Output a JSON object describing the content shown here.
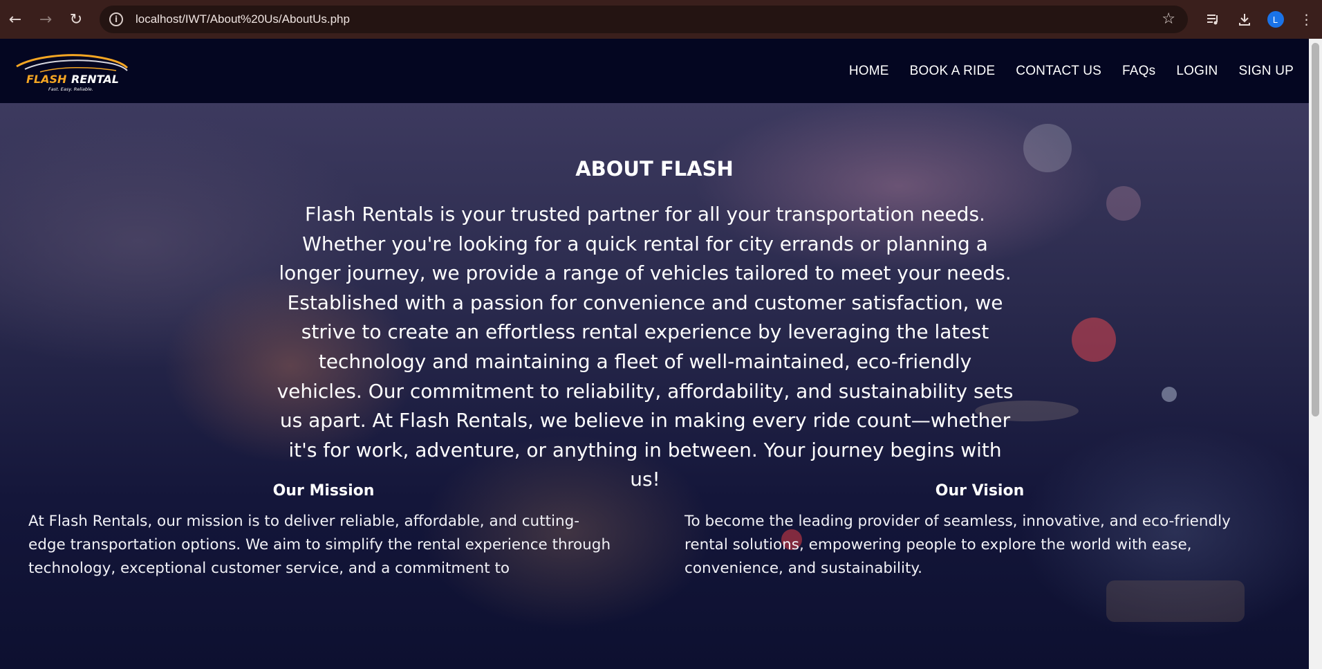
{
  "browser": {
    "url": "localhost/IWT/About%20Us/AboutUs.php",
    "profile_initial": "L",
    "icons": [
      "back-icon",
      "forward-icon",
      "reload-icon",
      "info-icon",
      "star-icon",
      "media-icon",
      "download-icon",
      "menu-icon"
    ]
  },
  "site": {
    "logo": {
      "name": "FLASH RENTAL",
      "tagline": "Fast. Easy. Reliable."
    },
    "nav": [
      "HOME",
      "BOOK A RIDE",
      "CONTACT US",
      "FAQs",
      "LOGIN",
      "SIGN UP"
    ]
  },
  "about": {
    "title": "ABOUT FLASH",
    "text": "Flash Rentals is your trusted partner for all your transportation needs. Whether you're looking for a quick rental for city errands or planning a longer journey, we provide a range of vehicles tailored to meet your needs. Established with a passion for convenience and customer satisfaction, we strive to create an effortless rental experience by leveraging the latest technology and maintaining a fleet of well-maintained, eco-friendly vehicles. Our commitment to reliability, affordability, and sustainability sets us apart. At Flash Rentals, we believe in making every ride count—whether it's for work, adventure, or anything in between. Your journey begins with us!"
  },
  "mission": {
    "title": "Our Mission",
    "text": "At Flash Rentals, our mission is to deliver reliable, affordable, and cutting-edge transportation options. We aim to simplify the rental experience through technology, exceptional customer service, and a commitment to"
  },
  "vision": {
    "title": "Our Vision",
    "text": "To become the leading provider of seamless, innovative, and eco-friendly rental solutions, empowering people to explore the world with ease, convenience, and sustainability."
  },
  "colors": {
    "chrome": "#3a1f1c",
    "nav_bg": "#040621",
    "logo_accent": "#f5a623"
  }
}
